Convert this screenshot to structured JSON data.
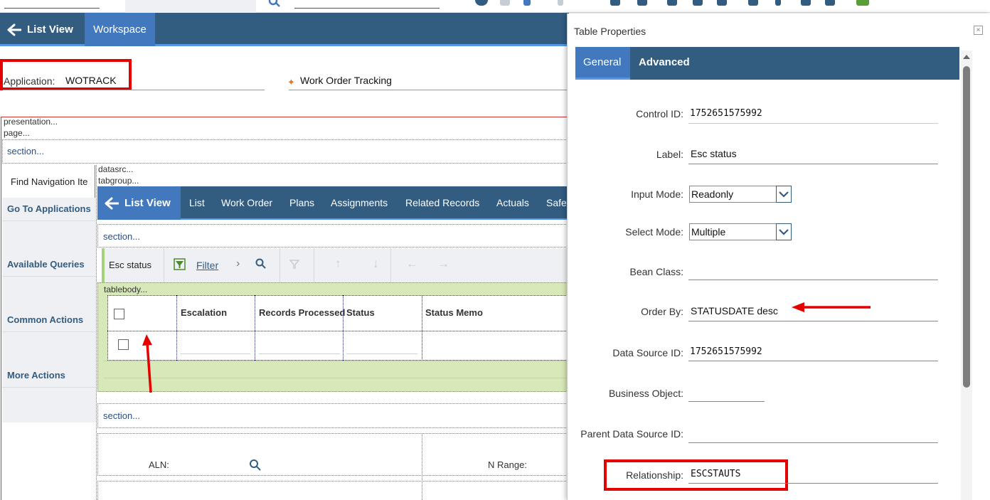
{
  "header": {
    "list_view_label": "List View",
    "workspace_label": "Workspace"
  },
  "application": {
    "label": "Application:",
    "value": "WOTRACK",
    "description": "Work Order Tracking"
  },
  "canvas": {
    "presentation_label": "presentation...",
    "page_label": "page...",
    "section_label": "section...",
    "datasrc_label": "datasrc...",
    "tabgroup_label": "tabgroup...",
    "tablebody_label": "tablebody...",
    "find_navigation": "Find Navigation Ite"
  },
  "sidebar": {
    "items": [
      {
        "label": "Go To Applications"
      },
      {
        "label": "Available Queries"
      },
      {
        "label": "Common Actions"
      },
      {
        "label": "More Actions"
      }
    ]
  },
  "inner_nav": {
    "list_view_label": "List View",
    "tabs": [
      {
        "label": "List"
      },
      {
        "label": "Work Order"
      },
      {
        "label": "Plans"
      },
      {
        "label": "Assignments"
      },
      {
        "label": "Related Records"
      },
      {
        "label": "Actuals"
      },
      {
        "label": "Safe"
      }
    ]
  },
  "table": {
    "title": "Esc status",
    "filter_label": "Filter",
    "columns": [
      "Escalation",
      "Records Processed",
      "Status",
      "Status Memo"
    ]
  },
  "bottom_section": {
    "aln_label": "ALN:",
    "nrange_label": "N Range:"
  },
  "dialog": {
    "title": "Table Properties",
    "close_icon": "×",
    "tabs": [
      {
        "label": "General",
        "active": true
      },
      {
        "label": "Advanced",
        "active": false
      }
    ],
    "fields": {
      "control_id": {
        "label": "Control ID:",
        "value": "1752651575992"
      },
      "label": {
        "label": "Label:",
        "value": "Esc status"
      },
      "input_mode": {
        "label": "Input Mode:",
        "value": "Readonly"
      },
      "select_mode": {
        "label": "Select Mode:",
        "value": "Multiple"
      },
      "bean_class": {
        "label": "Bean Class:",
        "value": ""
      },
      "order_by": {
        "label": "Order By:",
        "value": "STATUSDATE desc"
      },
      "data_source_id": {
        "label": "Data Source ID:",
        "value": "1752651575992"
      },
      "business_object": {
        "label": "Business Object:",
        "value": ""
      },
      "parent_data_source_id": {
        "label": "Parent Data Source ID:",
        "value": ""
      },
      "relationship": {
        "label": "Relationship:",
        "value": "ESCSTAUTS"
      }
    }
  },
  "colors": {
    "nav_dark": "#325c80",
    "nav_active": "#4178be",
    "accent_line": "#5596e6",
    "highlight_red": "#e50000",
    "tablebody_green": "#d8e9b9"
  }
}
